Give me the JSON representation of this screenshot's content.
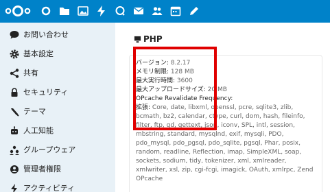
{
  "topbar": {
    "apps": [
      {
        "icon": "dashboard-icon"
      },
      {
        "icon": "files-icon"
      },
      {
        "icon": "photos-icon"
      },
      {
        "icon": "activity-icon"
      },
      {
        "icon": "search-icon"
      },
      {
        "icon": "mail-icon"
      },
      {
        "icon": "contacts-icon"
      },
      {
        "icon": "calendar-icon"
      },
      {
        "icon": "notes-icon"
      }
    ]
  },
  "sidebar": {
    "items": [
      {
        "label": "お問い合わせ",
        "icon": "chat-icon"
      },
      {
        "label": "基本設定",
        "icon": "gear-icon"
      },
      {
        "label": "共有",
        "icon": "share-icon"
      },
      {
        "label": "セキュリティ",
        "icon": "lock-icon"
      },
      {
        "label": "テーマ",
        "icon": "brush-icon"
      },
      {
        "label": "人工知能",
        "icon": "robot-icon"
      },
      {
        "label": "グループウェア",
        "icon": "groupware-icon"
      },
      {
        "label": "管理者権限",
        "icon": "admin-icon"
      },
      {
        "label": "アクティビティ",
        "icon": "activity-icon"
      }
    ]
  },
  "main": {
    "title": "PHP",
    "info": {
      "version_label": "バージョン:",
      "version_value": "8.2.17",
      "memory_label": "メモリ制限:",
      "memory_value": "128 MB",
      "exec_label": "最大実行時間:",
      "exec_value": "3600",
      "upload_label": "最大アップロードサイズ:",
      "upload_value": "20 MB",
      "opcache_label": "OPcache Revalidate Frequency:",
      "opcache_value": "",
      "ext_label": "拡張:",
      "ext_value": "Core, date, libxml, openssl, pcre, sqlite3, zlib, bcmath, bz2, calendar, ctype, curl, dom, hash, fileinfo, filter, ftp, gd, gettext, json, iconv, SPL, intl, session, mbstring, standard, mysqlnd, exif, mysqli, PDO, pdo_mysql, pdo_pgsql, pdo_sqlite, pgsql, Phar, posix, random, readline, Reflection, imap, SimpleXML, soap, sockets, sodium, tidy, tokenizer, xml, xmlreader, xmlwriter, xsl, zip, cgi-fcgi, imagick, OAuth, xmlrpc, Zend OPcache"
    }
  },
  "colors": {
    "header": "#0082c9",
    "sidebar": "#e8f1f7",
    "highlight": "#e00000"
  }
}
